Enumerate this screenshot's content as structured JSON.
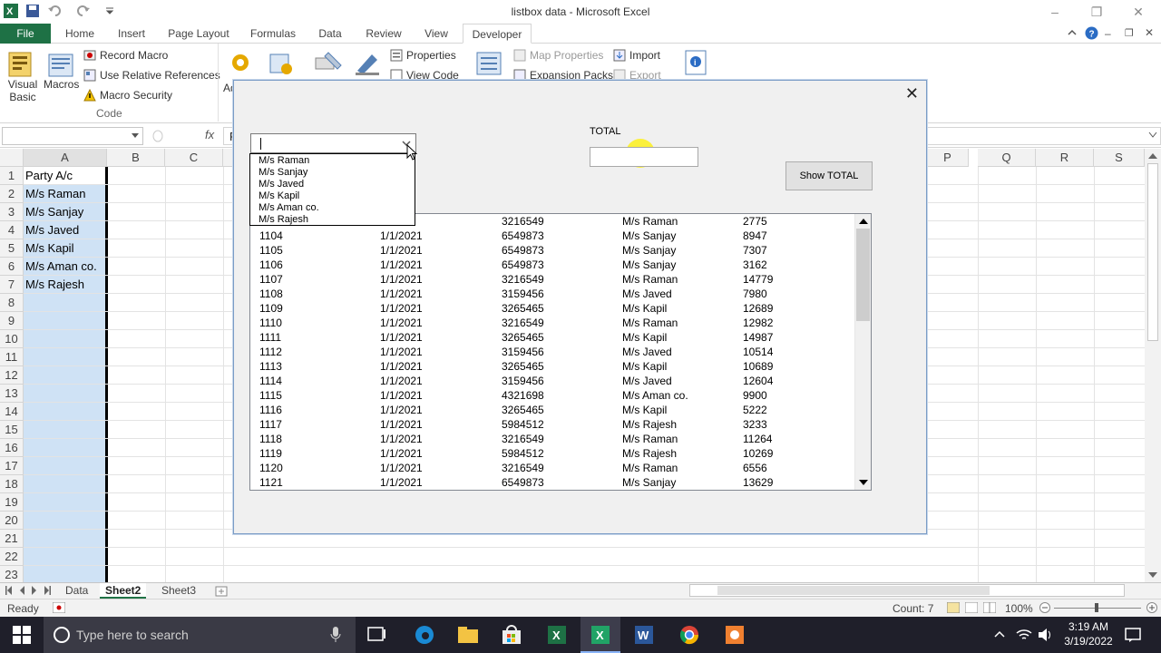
{
  "window": {
    "title": "listbox data  -  Microsoft Excel"
  },
  "ribbon_tabs": [
    "File",
    "Home",
    "Insert",
    "Page Layout",
    "Formulas",
    "Data",
    "Review",
    "View",
    "Developer"
  ],
  "ribbon": {
    "visual_basic": "Visual\nBasic",
    "visual_basic_l1": "Visual",
    "visual_basic_l2": "Basic",
    "macros": "Macros",
    "record_macro": "Record Macro",
    "relative_refs": "Use Relative References",
    "macro_security": "Macro Security",
    "code_group": "Code",
    "add_partial": "Ad",
    "properties": "Properties",
    "view_code": "View Code",
    "map_properties": "Map Properties",
    "import": "Import",
    "expansion_packs": "Expansion Packs",
    "export": "Export"
  },
  "formula_bar": {
    "fx": "fx",
    "partial": "P"
  },
  "columns_left": [
    "A",
    "B",
    "C"
  ],
  "columns_right": [
    "P",
    "Q",
    "R",
    "S"
  ],
  "rows": [
    "1",
    "2",
    "3",
    "4",
    "5",
    "6",
    "7",
    "8",
    "9",
    "10",
    "11",
    "12",
    "13",
    "14",
    "15",
    "16",
    "17",
    "18",
    "19",
    "20",
    "21",
    "22",
    "23"
  ],
  "column_a": [
    "Party A/c",
    "M/s Raman",
    "M/s Sanjay",
    "M/s Javed",
    "M/s Kapil",
    "M/s Aman co.",
    "M/s Rajesh"
  ],
  "sheet_tabs": [
    "Data",
    "Sheet2",
    "Sheet3"
  ],
  "status": {
    "ready": "Ready",
    "count": "Count: 7",
    "zoom": "100%"
  },
  "taskbar": {
    "search_placeholder": "Type here to search",
    "time": "3:19 AM",
    "date": "3/19/2022"
  },
  "dialog": {
    "total_label": "TOTAL",
    "total_value": "",
    "combo_value": "",
    "show_total_button": "Show TOTAL",
    "dropdown_options": [
      "M/s Raman",
      "M/s Sanjay",
      "M/s Javed",
      "M/s Kapil",
      "M/s Aman co.",
      "M/s Rajesh"
    ],
    "partial_first_row": {
      "date": "21",
      "code": "3216549",
      "party": "M/s Raman",
      "amount": "2775"
    },
    "list_rows": [
      {
        "id": "1104",
        "date": "1/1/2021",
        "code": "6549873",
        "party": "M/s Sanjay",
        "amount": "8947"
      },
      {
        "id": "1105",
        "date": "1/1/2021",
        "code": "6549873",
        "party": "M/s Sanjay",
        "amount": "7307"
      },
      {
        "id": "1106",
        "date": "1/1/2021",
        "code": "6549873",
        "party": "M/s Sanjay",
        "amount": "3162"
      },
      {
        "id": "1107",
        "date": "1/1/2021",
        "code": "3216549",
        "party": "M/s Raman",
        "amount": "14779"
      },
      {
        "id": "1108",
        "date": "1/1/2021",
        "code": "3159456",
        "party": "M/s Javed",
        "amount": "7980"
      },
      {
        "id": "1109",
        "date": "1/1/2021",
        "code": "3265465",
        "party": "M/s Kapil",
        "amount": "12689"
      },
      {
        "id": "1110",
        "date": "1/1/2021",
        "code": "3216549",
        "party": "M/s Raman",
        "amount": "12982"
      },
      {
        "id": "1111",
        "date": "1/1/2021",
        "code": "3265465",
        "party": "M/s Kapil",
        "amount": "14987"
      },
      {
        "id": "1112",
        "date": "1/1/2021",
        "code": "3159456",
        "party": "M/s Javed",
        "amount": "10514"
      },
      {
        "id": "1113",
        "date": "1/1/2021",
        "code": "3265465",
        "party": "M/s Kapil",
        "amount": "10689"
      },
      {
        "id": "1114",
        "date": "1/1/2021",
        "code": "3159456",
        "party": "M/s Javed",
        "amount": "12604"
      },
      {
        "id": "1115",
        "date": "1/1/2021",
        "code": "4321698",
        "party": "M/s Aman co.",
        "amount": "9900"
      },
      {
        "id": "1116",
        "date": "1/1/2021",
        "code": "3265465",
        "party": "M/s Kapil",
        "amount": "5222"
      },
      {
        "id": "1117",
        "date": "1/1/2021",
        "code": "5984512",
        "party": "M/s Rajesh",
        "amount": "3233"
      },
      {
        "id": "1118",
        "date": "1/1/2021",
        "code": "3216549",
        "party": "M/s Raman",
        "amount": "11264"
      },
      {
        "id": "1119",
        "date": "1/1/2021",
        "code": "5984512",
        "party": "M/s Rajesh",
        "amount": "10269"
      },
      {
        "id": "1120",
        "date": "1/1/2021",
        "code": "3216549",
        "party": "M/s Raman",
        "amount": "6556"
      },
      {
        "id": "1121",
        "date": "1/1/2021",
        "code": "6549873",
        "party": "M/s Sanjay",
        "amount": "13629"
      }
    ]
  },
  "colors": {
    "excel_green": "#1e7145",
    "selection": "#cfe2f5",
    "taskbar": "#1f1f2a"
  },
  "icons": [
    "excel-logo-icon",
    "save-icon",
    "undo-icon",
    "redo-icon",
    "help-icon",
    "close-icon",
    "windows-start-icon",
    "search-icon",
    "microphone-icon"
  ]
}
